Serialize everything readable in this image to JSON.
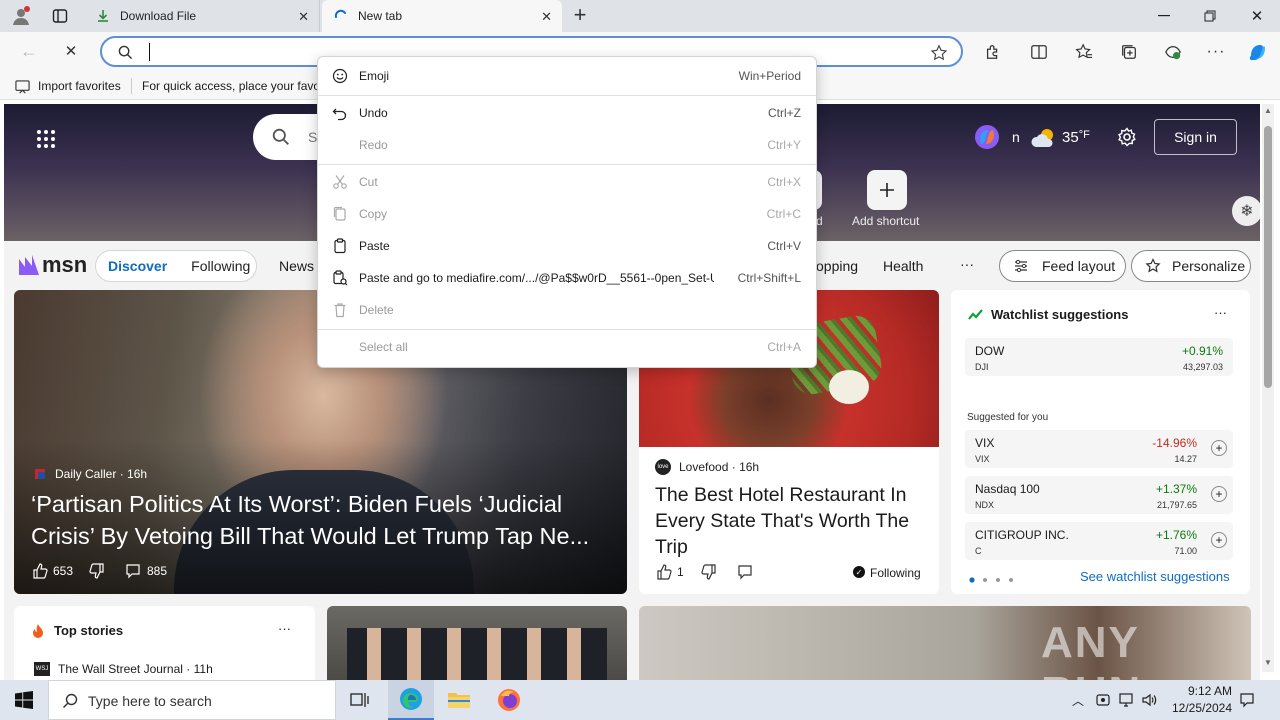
{
  "browser": {
    "tabs": [
      {
        "title": "Download File",
        "icon": "download-icon"
      },
      {
        "title": "New tab",
        "icon": "loading-spinner-icon"
      }
    ],
    "new_tab_symbol": "+",
    "favorites_bar": {
      "import_label": "Import favorites",
      "hint": "For quick access, place your favo"
    }
  },
  "context_menu": {
    "items": [
      {
        "label": "Emoji",
        "shortcut": "Win+Period",
        "enabled": true,
        "icon": "emoji-icon"
      },
      {
        "label": "Undo",
        "shortcut": "Ctrl+Z",
        "enabled": true,
        "icon": "undo-icon"
      },
      {
        "label": "Redo",
        "shortcut": "Ctrl+Y",
        "enabled": false,
        "icon": "redo-icon"
      },
      {
        "label": "Cut",
        "shortcut": "Ctrl+X",
        "enabled": false,
        "icon": "cut-icon"
      },
      {
        "label": "Copy",
        "shortcut": "Ctrl+C",
        "enabled": false,
        "icon": "copy-icon"
      },
      {
        "label": "Paste",
        "shortcut": "Ctrl+V",
        "enabled": true,
        "icon": "paste-icon"
      },
      {
        "label": "Paste and go to mediafire.com/.../@Pa$$w0rD__5561--0pen_Set-Up",
        "shortcut": "Ctrl+Shift+L",
        "enabled": true,
        "icon": "paste-go-icon"
      },
      {
        "label": "Delete",
        "shortcut": "",
        "enabled": false,
        "icon": "delete-icon"
      },
      {
        "label": "Select all",
        "shortcut": "Ctrl+A",
        "enabled": false,
        "icon": ""
      }
    ]
  },
  "msn": {
    "search_partial": "S",
    "sign_in_partial": "n",
    "weather_temp": "35",
    "weather_unit": "°F",
    "sign_in": "Sign in",
    "add_shortcut": "Add shortcut",
    "shortcut_partial_label": "d",
    "logo": "msn",
    "nav": {
      "discover": "Discover",
      "following": "Following",
      "news": "News",
      "shopping": "opping",
      "health": "Health",
      "more": "···"
    },
    "feed_layout": "Feed layout",
    "personalize": "Personalize",
    "hero": {
      "source": "Daily Caller",
      "time": "16h",
      "headline": "‘Partisan Politics At Its Worst’: Biden Fuels ‘Judicial Crisis’ By Vetoing Bill That Would Let Trump Tap Ne...",
      "likes": "653",
      "comments": "885"
    },
    "food": {
      "source": "Lovefood",
      "time": "16h",
      "headline": "The Best Hotel Restaurant In Every State That's Worth The Trip",
      "likes": "1",
      "following": "Following"
    },
    "watchlist": {
      "title": "Watchlist suggestions",
      "more": "···",
      "suggested_label": "Suggested for you",
      "link": "See watchlist suggestions",
      "main": {
        "name": "DOW",
        "symbol": "DJI",
        "change": "+0.91%",
        "price": "43,297.03"
      },
      "items": [
        {
          "name": "VIX",
          "symbol": "VIX",
          "change": "-14.96%",
          "price": "14.27",
          "dir": "down"
        },
        {
          "name": "Nasdaq 100",
          "symbol": "NDX",
          "change": "+1.37%",
          "price": "21,797.65",
          "dir": "up"
        },
        {
          "name": "CITIGROUP INC.",
          "symbol": "C",
          "change": "+1.76%",
          "price": "71.00",
          "dir": "up"
        }
      ]
    },
    "top_stories": {
      "title": "Top stories",
      "more": "···",
      "first_source": "The Wall Street Journal",
      "first_time": "11h"
    },
    "watermark": "ANY RUN"
  },
  "taskbar": {
    "search_placeholder": "Type here to search",
    "time": "9:12 AM",
    "date": "12/25/2024"
  },
  "colors": {
    "accent": "#0f6cbd",
    "omnibox_border": "#5b8fd8",
    "positive": "#0e7a0d",
    "negative": "#c42b1c"
  }
}
